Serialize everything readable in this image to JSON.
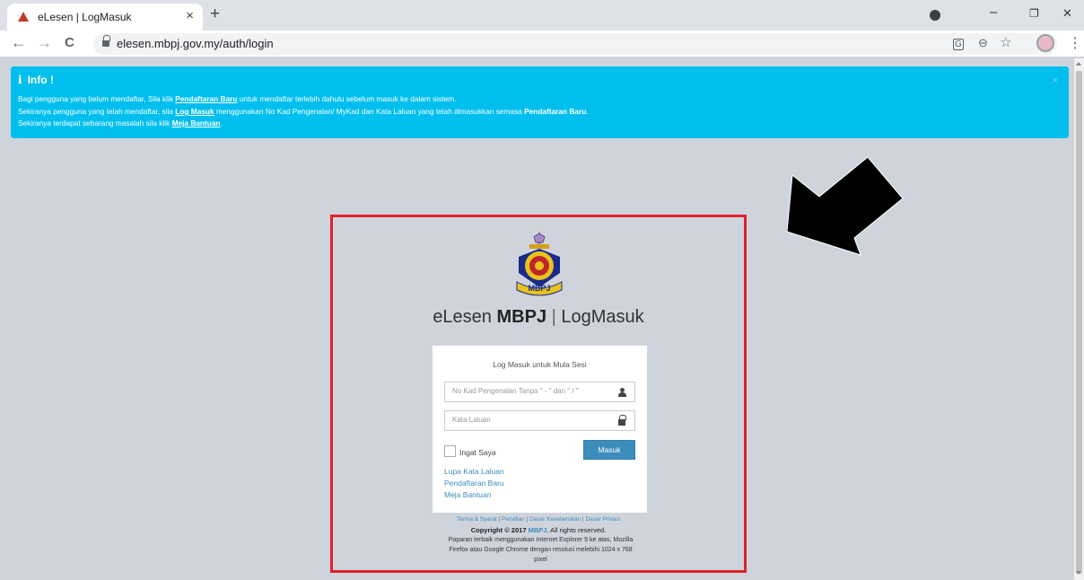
{
  "browser": {
    "tab_title": "eLesen | LogMasuk",
    "tab_close": "×",
    "new_tab": "+",
    "url": "elesen.mbpj.gov.my/auth/login",
    "back": "←",
    "forward": "→",
    "reload": "C",
    "translate_icon": "translate-icon",
    "zoom_icon": "zoom-icon",
    "star_icon": "☆",
    "menu": "⋮",
    "minimize": "–",
    "restore": "❐",
    "close": "✕"
  },
  "info": {
    "title": "Info !",
    "close": "×",
    "line1": {
      "pre": "Bagi pengguna yang belum mendaftar, Sila klik ",
      "link": "Pendaftaran Baru",
      "post": " untuk mendaftar terlebih dahulu sebelum masuk ke dalam sistem."
    },
    "line2": {
      "pre": "Sekiranya pengguna yang telah mendaftar, sila ",
      "link": "Log Masuk",
      "mid": " menggunakan No Kad Pengenalan/ MyKad dan Kata Laluan yang telah dimasukkan semasa ",
      "bold": "Pendaftaran Baru",
      "post": "."
    },
    "line3": {
      "pre": "Sekiranya terdapat sebarang masalah sila klik ",
      "link": "Meja Bantuan",
      "post": "."
    }
  },
  "header": {
    "logo_text": "MBPJ",
    "app_name": "eLesen",
    "brand": "MBPJ",
    "separator": "|",
    "page_name": "LogMasuk"
  },
  "login": {
    "heading": "Log Masuk untuk Mula Sesi",
    "ic_placeholder": "No Kad Pengenalan Tanpa \" - \" dan \" / \"",
    "password_placeholder": "Kata Laluan",
    "remember_label": "Ingat Saya",
    "submit_label": "Masuk",
    "links": [
      "Lupa Kata Laluan",
      "Pendaftaran Baru",
      "Meja Bantuan"
    ]
  },
  "footer": {
    "links": [
      "Terma & Syarat",
      "Penafian",
      "Dasar Keselamatan",
      "Dasar Privasi"
    ],
    "copyright_pre": "Copyright © 2017 ",
    "copyright_org": "MBPJ",
    "copyright_post": ". All rights reserved.",
    "note_lines": [
      "Paparan terbaik menggunakan Internet Explorer 9 ke atas, Mozilla",
      "Firefox atau Google Chrome dengan resolusi melebihi 1024 x 768",
      "pixel"
    ]
  },
  "colors": {
    "info_banner": "#00bfef",
    "highlight": "#e0202a",
    "button": "#3c8dbc",
    "page_bg": "#cfd4dc"
  }
}
